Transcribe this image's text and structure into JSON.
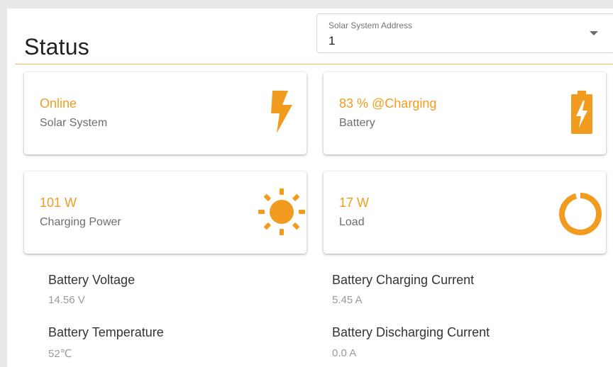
{
  "header": {
    "title": "Status",
    "address_select": {
      "label": "Solar System Address",
      "value": "1",
      "icon": "chevron-down-icon"
    }
  },
  "cards": [
    {
      "value": "Online",
      "label": "Solar System",
      "icon": "lightning-bolt-icon"
    },
    {
      "value": "83 % @Charging",
      "label": "Battery",
      "icon": "battery-charging-icon"
    },
    {
      "value": "101 W",
      "label": "Charging Power",
      "icon": "sun-icon"
    },
    {
      "value": "17 W",
      "label": "Load",
      "icon": "donut-load-icon"
    }
  ],
  "details": [
    {
      "label": "Battery Voltage",
      "value": "14.56 V"
    },
    {
      "label": "Battery Charging Current",
      "value": "5.45 A"
    },
    {
      "label": "Battery Temperature",
      "value": "52℃"
    },
    {
      "label": "Battery Discharging Current",
      "value": "0.0 A"
    }
  ],
  "colors": {
    "accent": "#f29c1f",
    "divider": "#f2b85b",
    "label": "#6d6d6d",
    "muted_value": "#9a9a9a"
  }
}
